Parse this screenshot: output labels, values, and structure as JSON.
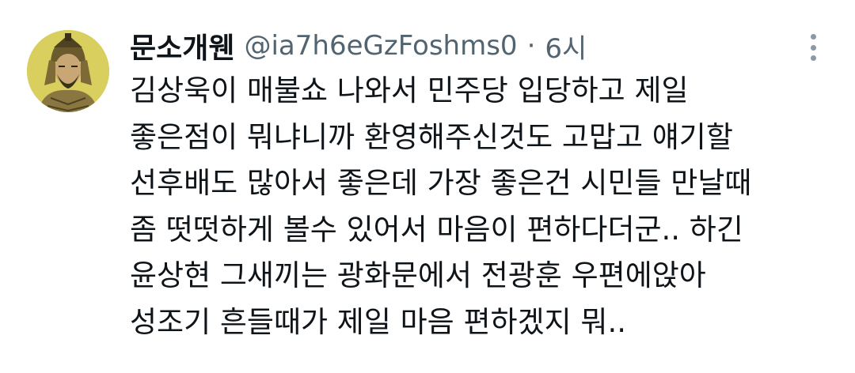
{
  "tweet": {
    "display_name": "문소개웬",
    "handle": "@ia7h6eGzFoshms0",
    "separator": "·",
    "time": "6시",
    "avatar_icon": "warrior-portrait-icon",
    "more_icon": "more-vertical-icon",
    "text_lines": [
      "김상욱이 매불쇼 나와서 민주당 입당하고 제일",
      "좋은점이 뭐냐니까 환영해주신것도 고맙고 얘기할",
      "선후배도 많아서 좋은데 가장 좋은건 시민들 만날때",
      "좀 떳떳하게 볼수 있어서 마음이 편하다더군.. 하긴",
      "윤상현 그새끼는 광화문에서 전광훈 우편에앉아",
      "성조기 흔들때가 제일 마음 편하겠지 뭐.."
    ]
  },
  "colors": {
    "text_primary": "#0f1419",
    "text_secondary": "#536471",
    "avatar_bg": "#d8cf5e"
  }
}
